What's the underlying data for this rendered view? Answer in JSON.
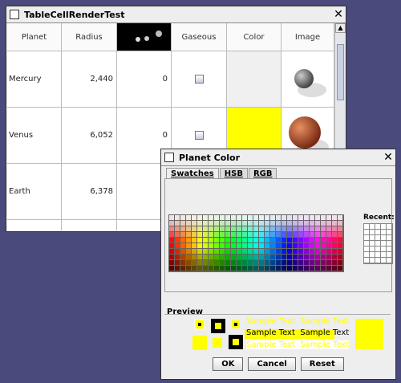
{
  "main_window": {
    "title": "TableCellRenderTest",
    "close_glyph": "✕",
    "columns": [
      "Planet",
      "Radius",
      "",
      "Gaseous",
      "Color",
      "Image"
    ],
    "rows": [
      {
        "planet": "Mercury",
        "radius": "2,440",
        "moons": "0",
        "color": "#f0f0f0",
        "image": "mercury-image"
      },
      {
        "planet": "Venus",
        "radius": "6,052",
        "moons": "0",
        "color": "#ffff00",
        "image": "venus-image"
      },
      {
        "planet": "Earth",
        "radius": "6,378",
        "moons": "",
        "color": "",
        "image": ""
      }
    ]
  },
  "dialog": {
    "title": "Planet Color",
    "close_glyph": "✕",
    "tabs": [
      "Swatches",
      "HSB",
      "RGB"
    ],
    "recent_label": "Recent:",
    "preview_label": "Preview",
    "sample_text": "Sample Text",
    "buttons": {
      "ok": "OK",
      "cancel": "Cancel",
      "reset": "Reset"
    },
    "selected_color": "#ffff00"
  }
}
